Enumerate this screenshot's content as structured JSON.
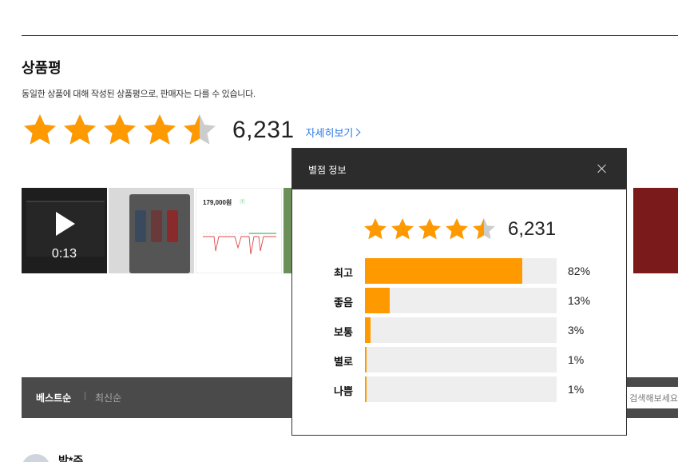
{
  "section": {
    "title": "상품평",
    "description": "동일한 상품에 대해 작성된 상품평으로, 판매자는 다를 수 있습니다."
  },
  "rating": {
    "value": 4.5,
    "max": 5,
    "count": "6,231",
    "detail_link": "자세히보기"
  },
  "media": {
    "video_duration": "0:13",
    "screenshot_price": "179,000원"
  },
  "sort": {
    "best": "베스트순",
    "separator": "|",
    "recent": "최신순",
    "search_placeholder": "검색해보세요"
  },
  "reviewer": {
    "name": "박*주"
  },
  "popup": {
    "title": "별점 정보",
    "rating_value": 4.5,
    "count": "6,231",
    "distribution": [
      {
        "label": "최고",
        "percent": 82,
        "text": "82%"
      },
      {
        "label": "좋음",
        "percent": 13,
        "text": "13%"
      },
      {
        "label": "보통",
        "percent": 3,
        "text": "3%"
      },
      {
        "label": "별로",
        "percent": 1,
        "text": "1%"
      },
      {
        "label": "나쁨",
        "percent": 1,
        "text": "1%"
      }
    ]
  },
  "colors": {
    "star": "#ff9900",
    "star_empty": "#cccccc",
    "link": "#2f7be8",
    "popup_header": "#2c2c2c",
    "sortbar": "#4a4a4a"
  }
}
